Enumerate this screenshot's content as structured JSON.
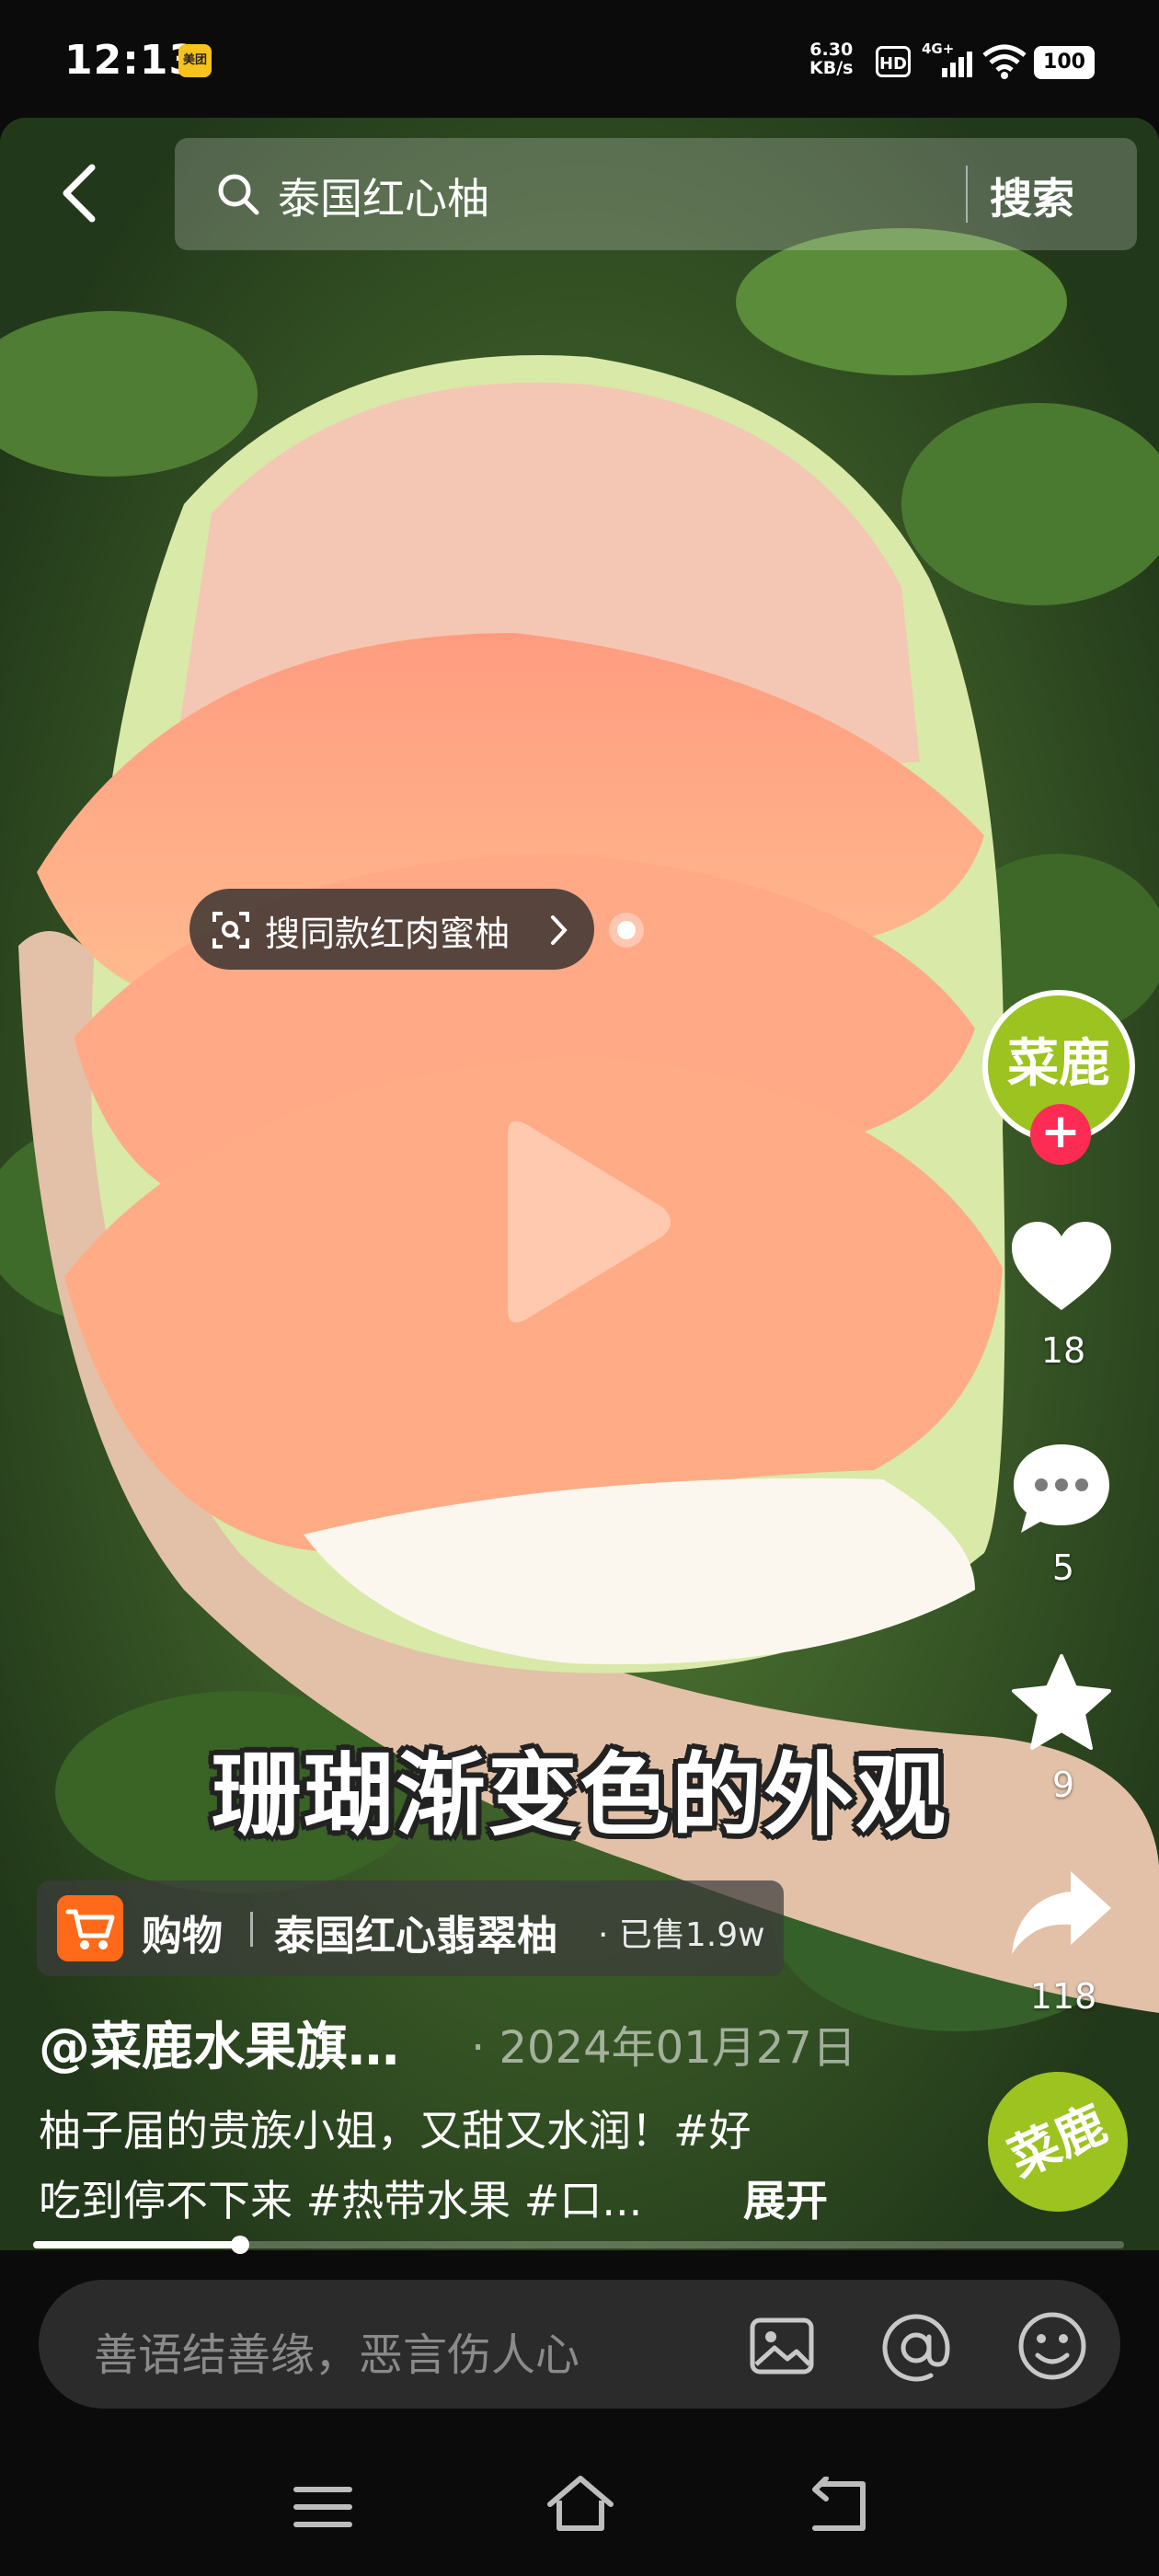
{
  "status_bar": {
    "time": "12:13",
    "app_badge": "美团",
    "net_speed_value": "6.30",
    "net_speed_unit": "KB/s",
    "hd_label": "HD",
    "network": "4G+",
    "battery": "100"
  },
  "search": {
    "query": "泰国红心柚",
    "button_label": "搜索"
  },
  "product_tag": {
    "label": "搜同款红肉蜜柚"
  },
  "sidebar": {
    "avatar_text": "菜鹿",
    "follow_symbol": "+",
    "likes": "18",
    "comments": "5",
    "favorites": "9",
    "shares": "118"
  },
  "video": {
    "subtitle": "珊瑚渐变色的外观",
    "progress": 0.19
  },
  "shop": {
    "label": "购物",
    "product": "泰国红心翡翠柚",
    "sold": "· 已售1.9w"
  },
  "post": {
    "username": "@菜鹿水果旗…",
    "date": "· 2024年01月27日",
    "caption_line1": "柚子届的贵族小姐，又甜又水润！#好",
    "caption_line2": "吃到停不下来 #热带水果 #口...",
    "expand_label": "展开",
    "brand_badge": "菜鹿"
  },
  "comment": {
    "placeholder": "善语结善缘，恶言伤人心"
  },
  "colors": {
    "brand_green": "#9cc31f",
    "follow_red": "#fe2c55",
    "cart_orange": "#ff6a1a"
  }
}
